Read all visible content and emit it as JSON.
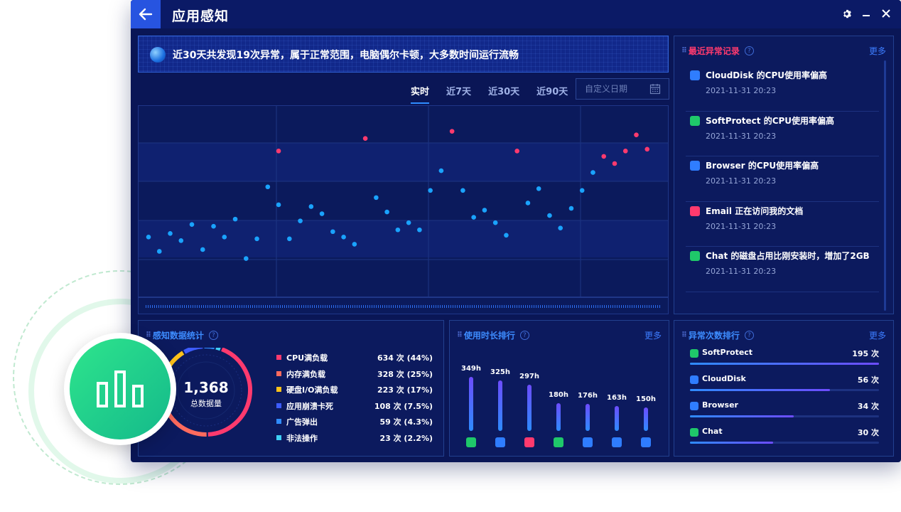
{
  "window": {
    "title": "应用感知"
  },
  "banner": {
    "text": "近30天共发现19次异常，属于正常范围，电脑偶尔卡顿，大多数时间运行流畅"
  },
  "tabs": [
    {
      "label": "实时",
      "active": true
    },
    {
      "label": "近7天",
      "active": false
    },
    {
      "label": "近30天",
      "active": false
    },
    {
      "label": "近90天",
      "active": false
    }
  ],
  "date_picker": {
    "placeholder": "自定义日期"
  },
  "chart_data": {
    "type": "scatter",
    "title": "",
    "xlabel": "",
    "ylabel": "",
    "grid": true,
    "colors": {
      "normal": "#1aa3ff",
      "anomaly": "#ff3a6e"
    },
    "ylim": [
      0,
      100
    ],
    "normal_points": [
      [
        1,
        34
      ],
      [
        2,
        26
      ],
      [
        3,
        36
      ],
      [
        4,
        32
      ],
      [
        5,
        41
      ],
      [
        6,
        27
      ],
      [
        7,
        40
      ],
      [
        8,
        34
      ],
      [
        9,
        44
      ],
      [
        10,
        22
      ],
      [
        11,
        33
      ],
      [
        12,
        62
      ],
      [
        13,
        52
      ],
      [
        14,
        33
      ],
      [
        15,
        43
      ],
      [
        16,
        51
      ],
      [
        17,
        47
      ],
      [
        18,
        37
      ],
      [
        19,
        34
      ],
      [
        20,
        30
      ],
      [
        22,
        56
      ],
      [
        23,
        48
      ],
      [
        24,
        38
      ],
      [
        25,
        42
      ],
      [
        26,
        38
      ],
      [
        27,
        60
      ],
      [
        28,
        71
      ],
      [
        30,
        60
      ],
      [
        31,
        45
      ],
      [
        32,
        49
      ],
      [
        33,
        42
      ],
      [
        34,
        35
      ],
      [
        36,
        53
      ],
      [
        37,
        61
      ],
      [
        38,
        46
      ],
      [
        39,
        39
      ],
      [
        40,
        50
      ],
      [
        41,
        60
      ],
      [
        42,
        70
      ]
    ],
    "anomaly_points": [
      [
        13,
        82
      ],
      [
        21,
        89
      ],
      [
        29,
        93
      ],
      [
        35,
        82
      ],
      [
        43,
        79
      ],
      [
        44,
        75
      ],
      [
        45,
        82
      ],
      [
        46,
        91
      ],
      [
        47,
        83
      ]
    ]
  },
  "recent": {
    "title": "最近异常记录",
    "more": "更多",
    "items": [
      {
        "icon": "cloud-disk-icon",
        "color": "#2f7dff",
        "message": "CloudDisk 的CPU使用率偏高",
        "time": "2021-11-31 20:23"
      },
      {
        "icon": "soft-protect-icon",
        "color": "#1fc86a",
        "message": "SoftProtect 的CPU使用率偏高",
        "time": "2021-11-31 20:23"
      },
      {
        "icon": "browser-icon",
        "color": "#2f7dff",
        "message": "Browser 的CPU使用率偏高",
        "time": "2021-11-31 20:23"
      },
      {
        "icon": "email-icon",
        "color": "#ff3a6e",
        "message": "Email 正在访问我的文档",
        "time": "2021-11-31 20:23"
      },
      {
        "icon": "chat-icon",
        "color": "#1fc86a",
        "message": "Chat 的磁盘占用比刚安装时，增加了2GB",
        "time": "2021-11-31 20:23"
      }
    ]
  },
  "stats": {
    "title": "感知数据统计",
    "total": "1,368",
    "total_label": "总数据量",
    "items": [
      {
        "label": "CPU满负载",
        "value": "634 次 (44%)",
        "share": 44,
        "color": "#ff3a6e"
      },
      {
        "label": "内存满负载",
        "value": "328 次 (25%)",
        "share": 25,
        "color": "#ff6b5e"
      },
      {
        "label": "硬盘I/O满负载",
        "value": "223 次 (17%)",
        "share": 17,
        "color": "#ffc21a"
      },
      {
        "label": "应用崩溃卡死",
        "value": "108 次 (7.5%)",
        "share": 7.5,
        "color": "#3d5cff"
      },
      {
        "label": "广告弹出",
        "value": "59 次 (4.3%)",
        "share": 4.3,
        "color": "#2f8cff"
      },
      {
        "label": "非法操作",
        "value": "23 次 (2.2%)",
        "share": 2.2,
        "color": "#3fd0f5"
      }
    ]
  },
  "usage": {
    "title": "使用时长排行",
    "more": "更多",
    "items": [
      {
        "value": "349h",
        "hours": 349,
        "icon": "chat-icon",
        "color": "#1fc86a"
      },
      {
        "value": "325h",
        "hours": 325,
        "icon": "browser-icon",
        "color": "#2f7dff"
      },
      {
        "value": "297h",
        "hours": 297,
        "icon": "email-icon",
        "color": "#ff3a6e"
      },
      {
        "value": "180h",
        "hours": 180,
        "icon": "music-icon",
        "color": "#1fc86a"
      },
      {
        "value": "176h",
        "hours": 176,
        "icon": "lightning-icon",
        "color": "#2f7dff"
      },
      {
        "value": "163h",
        "hours": 163,
        "icon": "cloud-disk-icon",
        "color": "#2f7dff"
      },
      {
        "value": "150h",
        "hours": 150,
        "icon": "document-icon",
        "color": "#2f7dff"
      }
    ]
  },
  "anomaly": {
    "title": "异常次数排行",
    "more": "更多",
    "items": [
      {
        "name": "SoftProtect",
        "count": "195 次",
        "level": 100,
        "icon": "soft-protect-icon",
        "color": "#1fc86a"
      },
      {
        "name": "CloudDisk",
        "count": "56 次",
        "level": 74,
        "icon": "cloud-disk-icon",
        "color": "#2f7dff"
      },
      {
        "name": "Browser",
        "count": "34 次",
        "level": 55,
        "icon": "browser-icon",
        "color": "#2f7dff"
      },
      {
        "name": "Chat",
        "count": "30 次",
        "level": 44,
        "icon": "chat-icon",
        "color": "#1fc86a"
      }
    ]
  }
}
